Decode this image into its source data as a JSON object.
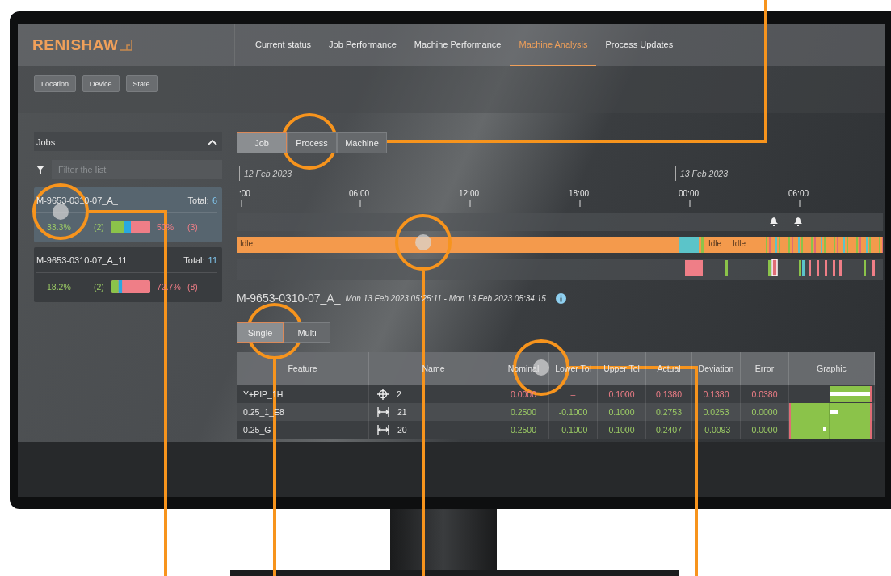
{
  "header": {
    "logo": "RENISHAW",
    "nav": [
      {
        "label": "Current status",
        "selected": false
      },
      {
        "label": "Job Performance",
        "selected": false
      },
      {
        "label": "Machine Performance",
        "selected": false
      },
      {
        "label": "Machine Analysis",
        "selected": true
      },
      {
        "label": "Process Updates",
        "selected": false
      }
    ]
  },
  "filters": [
    "Location",
    "Device",
    "State"
  ],
  "jobs_panel": {
    "title": "Jobs",
    "expanded": true,
    "filter": {
      "placeholder": "Filter the list"
    },
    "items": [
      {
        "name": "M-9653-0310-07_A_",
        "total_label": "Total:",
        "total": "6",
        "pass_pct": "33.3%",
        "pass_count": "(2)",
        "fail_pct": "50%",
        "fail_count": "(3)",
        "selected": true
      },
      {
        "name": "M-9653-0310-07_A_11",
        "total_label": "Total:",
        "total": "11",
        "pass_pct": "18.2%",
        "pass_count": "(2)",
        "fail_pct": "72.7%",
        "fail_count": "(8)",
        "selected": false
      }
    ]
  },
  "view_tabs": [
    {
      "label": "Job",
      "selected": true
    },
    {
      "label": "Process",
      "selected": false
    },
    {
      "label": "Machine",
      "selected": false
    }
  ],
  "timeline": {
    "dates": [
      "12 Feb 2023",
      "13 Feb 2023"
    ],
    "ticks": [
      ":00",
      "06:00",
      "12:00",
      "18:00",
      "00:00",
      "06:00"
    ],
    "state_labels": [
      "Idle",
      "Idle",
      "Idle"
    ]
  },
  "detail": {
    "title": "M-9653-0310-07_A_",
    "range": "Mon 13 Feb 2023 05:25:11 - Mon 13 Feb 2023 05:34:15",
    "modes": [
      {
        "label": "Single",
        "selected": true
      },
      {
        "label": "Multi",
        "selected": false
      }
    ],
    "table": {
      "columns": [
        "Feature",
        "Name",
        "Nominal",
        "Lower Tol",
        "Upper Tol",
        "Actual",
        "Deviation",
        "Error",
        "Graphic"
      ],
      "rows": [
        {
          "feature": "Y+PIP_1H",
          "kind": "position",
          "name": "2",
          "out_of_tolerance": true,
          "values": [
            "0.0000",
            "–",
            "0.1000",
            "0.1380",
            "0.1380",
            "0.0380"
          ]
        },
        {
          "feature": "0.25_1_E8",
          "kind": "width",
          "name": "21",
          "out_of_tolerance": false,
          "values": [
            "0.2500",
            "-0.1000",
            "0.1000",
            "0.2753",
            "0.0253",
            "0.0000"
          ]
        },
        {
          "feature": "0.25_G",
          "kind": "width",
          "name": "20",
          "out_of_tolerance": false,
          "values": [
            "0.2500",
            "-0.1000",
            "0.1000",
            "0.2407",
            "-0.0093",
            "0.0000"
          ]
        }
      ]
    }
  }
}
